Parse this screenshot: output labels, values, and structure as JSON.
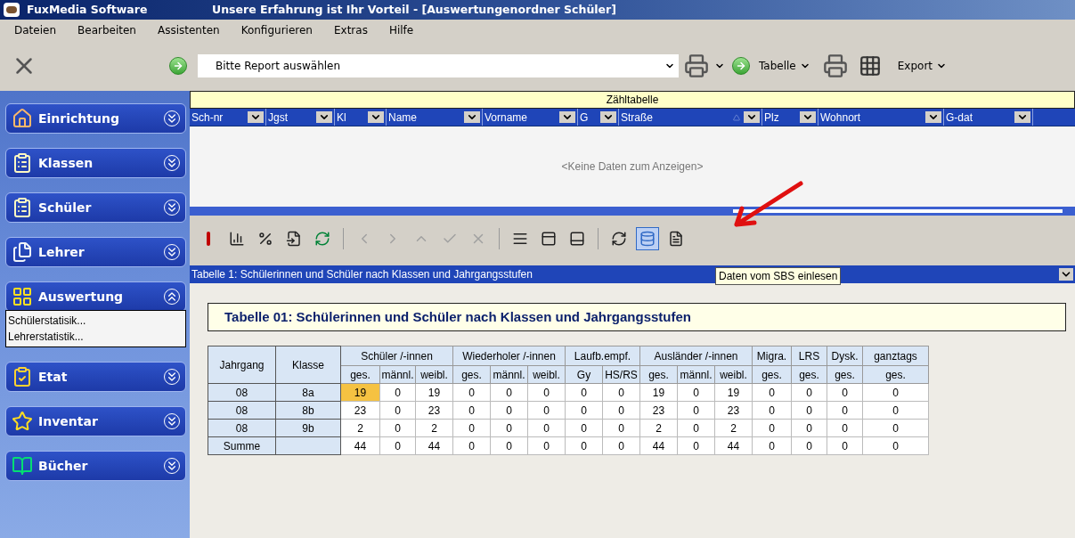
{
  "window": {
    "app_name": "FuxMedia Software",
    "title": "Unsere Erfahrung ist Ihr Vorteil - [Auswertungenordner Schüler]"
  },
  "menu": [
    "Dateien",
    "Bearbeiten",
    "Assistenten",
    "Konfigurieren",
    "Extras",
    "Hilfe"
  ],
  "toolbar": {
    "report_select": {
      "value": "Bitte Report auswählen"
    },
    "tabelle_button": "Tabelle",
    "export_button": "Export"
  },
  "sidebar": {
    "items": [
      {
        "label": "Einrichtung",
        "expanded": false
      },
      {
        "label": "Klassen",
        "expanded": false
      },
      {
        "label": "Schüler",
        "expanded": false
      },
      {
        "label": "Lehrer",
        "expanded": false
      },
      {
        "label": "Auswertung",
        "expanded": true,
        "children": [
          "Schülerstatisik...",
          "Lehrerstatistik..."
        ]
      },
      {
        "label": "Etat",
        "expanded": false
      },
      {
        "label": "Inventar",
        "expanded": false
      },
      {
        "label": "Bücher",
        "expanded": false
      }
    ]
  },
  "count_table": {
    "title": "Zähltabelle",
    "columns": [
      "Sch-nr",
      "Jgst",
      "Kl",
      "Name",
      "Vorname",
      "G",
      "Straße",
      "Plz",
      "Wohnort",
      "G-dat"
    ],
    "empty_message": "<Keine Daten zum Anzeigen>"
  },
  "grid_toolbar": {
    "buttons": [
      {
        "disabled": false,
        "selected": false
      },
      {
        "disabled": false,
        "selected": false
      },
      {
        "disabled": false,
        "selected": false
      },
      {
        "disabled": false,
        "selected": false
      },
      {
        "disabled": false,
        "selected": false
      },
      {
        "disabled": true,
        "selected": false
      },
      {
        "disabled": true,
        "selected": false
      },
      {
        "disabled": true,
        "selected": false
      },
      {
        "disabled": true,
        "selected": false
      },
      {
        "disabled": true,
        "selected": false
      },
      {
        "disabled": false,
        "selected": false
      },
      {
        "disabled": false,
        "selected": false
      },
      {
        "disabled": false,
        "selected": false
      },
      {
        "disabled": false,
        "selected": false
      },
      {
        "disabled": false,
        "selected": true
      },
      {
        "disabled": false,
        "selected": false
      }
    ],
    "tooltip": "Daten vom SBS einlesen"
  },
  "report_dropdown": {
    "value": "Tabelle 1: Schülerinnen und Schüler nach Klassen und Jahrgangsstufen"
  },
  "report": {
    "title": "Tabelle 01:  Schülerinnen und Schüler nach Klassen und Jahrgangsstufen",
    "row_headers": [
      "Jahrgang",
      "Klasse"
    ],
    "groups": [
      {
        "label": "Schüler /-innen",
        "subcolumns": [
          "ges.",
          "männl.",
          "weibl."
        ]
      },
      {
        "label": "Wiederholer /-innen",
        "subcolumns": [
          "ges.",
          "männl.",
          "weibl."
        ]
      },
      {
        "label": "Laufb.empf.",
        "subcolumns": [
          "Gy",
          "HS/RS"
        ]
      },
      {
        "label": "Ausländer /-innen",
        "subcolumns": [
          "ges.",
          "männl.",
          "weibl."
        ]
      },
      {
        "label": "Migra.",
        "subcolumns": [
          "ges."
        ]
      },
      {
        "label": "LRS",
        "subcolumns": [
          "ges."
        ]
      },
      {
        "label": "Dysk.",
        "subcolumns": [
          "ges."
        ]
      },
      {
        "label": "ganztags",
        "subcolumns": [
          "ges."
        ]
      }
    ],
    "rows": [
      {
        "jahrgang": "08",
        "klasse": "8a",
        "values": [
          {
            "text": "19",
            "selected": true
          },
          {
            "text": "0",
            "selected": false
          },
          {
            "text": "19",
            "selected": false
          },
          {
            "text": "0",
            "selected": false
          },
          {
            "text": "0",
            "selected": false
          },
          {
            "text": "0",
            "selected": false
          },
          {
            "text": "0",
            "selected": false
          },
          {
            "text": "0",
            "selected": false
          },
          {
            "text": "19",
            "selected": false
          },
          {
            "text": "0",
            "selected": false
          },
          {
            "text": "19",
            "selected": false
          },
          {
            "text": "0",
            "selected": false
          },
          {
            "text": "0",
            "selected": false
          },
          {
            "text": "0",
            "selected": false
          },
          {
            "text": "0",
            "selected": false
          }
        ]
      },
      {
        "jahrgang": "08",
        "klasse": "8b",
        "values": [
          {
            "text": "23",
            "selected": false
          },
          {
            "text": "0",
            "selected": false
          },
          {
            "text": "23",
            "selected": false
          },
          {
            "text": "0",
            "selected": false
          },
          {
            "text": "0",
            "selected": false
          },
          {
            "text": "0",
            "selected": false
          },
          {
            "text": "0",
            "selected": false
          },
          {
            "text": "0",
            "selected": false
          },
          {
            "text": "23",
            "selected": false
          },
          {
            "text": "0",
            "selected": false
          },
          {
            "text": "23",
            "selected": false
          },
          {
            "text": "0",
            "selected": false
          },
          {
            "text": "0",
            "selected": false
          },
          {
            "text": "0",
            "selected": false
          },
          {
            "text": "0",
            "selected": false
          }
        ]
      },
      {
        "jahrgang": "08",
        "klasse": "9b",
        "values": [
          {
            "text": "2",
            "selected": false
          },
          {
            "text": "0",
            "selected": false
          },
          {
            "text": "2",
            "selected": false
          },
          {
            "text": "0",
            "selected": false
          },
          {
            "text": "0",
            "selected": false
          },
          {
            "text": "0",
            "selected": false
          },
          {
            "text": "0",
            "selected": false
          },
          {
            "text": "0",
            "selected": false
          },
          {
            "text": "2",
            "selected": false
          },
          {
            "text": "0",
            "selected": false
          },
          {
            "text": "2",
            "selected": false
          },
          {
            "text": "0",
            "selected": false
          },
          {
            "text": "0",
            "selected": false
          },
          {
            "text": "0",
            "selected": false
          },
          {
            "text": "0",
            "selected": false
          }
        ]
      },
      {
        "jahrgang": "Summe",
        "values": [
          {
            "text": "44",
            "selected": false
          },
          {
            "text": "0",
            "selected": false
          },
          {
            "text": "44",
            "selected": false
          },
          {
            "text": "0",
            "selected": false
          },
          {
            "text": "0",
            "selected": false
          },
          {
            "text": "0",
            "selected": false
          },
          {
            "text": "0",
            "selected": false
          },
          {
            "text": "0",
            "selected": false
          },
          {
            "text": "44",
            "selected": false
          },
          {
            "text": "0",
            "selected": false
          },
          {
            "text": "44",
            "selected": false
          },
          {
            "text": "0",
            "selected": false
          },
          {
            "text": "0",
            "selected": false
          },
          {
            "text": "0",
            "selected": false
          },
          {
            "text": "0",
            "selected": false
          }
        ]
      }
    ]
  }
}
